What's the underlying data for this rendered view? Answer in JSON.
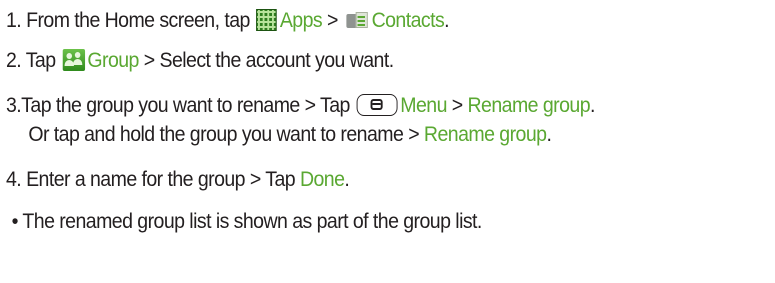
{
  "steps": [
    {
      "number": "1.",
      "text_a": "From the Home screen, tap",
      "link_a": "Apps",
      "sep_a": ">",
      "link_b": "Contacts",
      "end": "."
    },
    {
      "number": "2.",
      "text_a": "Tap",
      "link_a": "Group",
      "sep_a": ">",
      "text_b": "Select the account you want."
    },
    {
      "number": "3.",
      "text_a": "Tap the group you want to rename",
      "sep_a": ">",
      "text_b": "Tap",
      "link_a": "Menu",
      "sep_b": ">",
      "link_b": "Rename group",
      "end": ".",
      "alt_a": "Or tap and hold the group you want to rename",
      "alt_sep": ">",
      "alt_link": "Rename group",
      "alt_end": "."
    },
    {
      "number": "4.",
      "text_a": "Enter a name for the group",
      "sep_a": ">",
      "text_b": "Tap",
      "link_a": "Done",
      "end": "."
    }
  ],
  "note": {
    "bullet": "•",
    "text": "The renamed group list is shown as part of the group list."
  },
  "colors": {
    "text": "#231f20",
    "highlight": "#5aa832"
  },
  "icons": [
    "apps-grid-icon",
    "contacts-icon",
    "group-icon",
    "menu-key-icon"
  ]
}
